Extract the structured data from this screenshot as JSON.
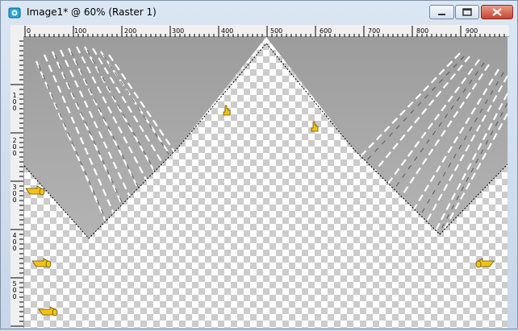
{
  "window": {
    "title": "Image1* @  60% (Raster 1)",
    "icon": "paint-palette-icon",
    "buttons": [
      "minimize-icon",
      "maximize-icon",
      "close-icon"
    ]
  },
  "ruler_top": {
    "labels": [
      "0",
      "100",
      "200",
      "300",
      "400",
      "500",
      "600",
      "700",
      "800",
      "900"
    ]
  },
  "ruler_left": {
    "labels": [
      "1",
      "0",
      "0",
      "2",
      "0",
      "0",
      "3",
      "0",
      "0",
      "4",
      "0",
      "0",
      "5",
      "0",
      "0"
    ]
  },
  "canvas": {
    "gray_color": "#a6a6a6",
    "checker_light": "#ffffff",
    "checker_dark": "#cccccc",
    "pointer_icons": [
      "hand-pointer-icon",
      "hand-pointer-icon",
      "hand-pointer-icon",
      "hand-pointer-icon",
      "hand-pointer-icon",
      "hand-pointer-icon"
    ]
  }
}
